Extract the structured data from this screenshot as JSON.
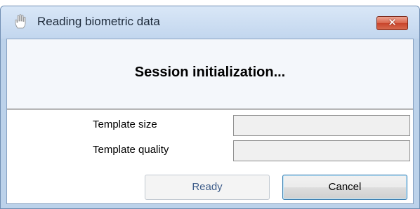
{
  "window": {
    "title": "Reading biometric data",
    "close_symbol": "✕",
    "title_icon": "hand-icon"
  },
  "status": {
    "message": "Session initialization..."
  },
  "fields": {
    "template_size_label": "Template size",
    "template_size_value": "",
    "template_quality_label": "Template quality",
    "template_quality_value": ""
  },
  "buttons": {
    "ready_label": "Ready",
    "ready_enabled": false,
    "cancel_label": "Cancel"
  },
  "colors": {
    "title_bar": "#c8dbf1",
    "close_button": "#d9654c",
    "status_panel": "#f4f7fb",
    "disabled_text": "#3e5d8a"
  }
}
